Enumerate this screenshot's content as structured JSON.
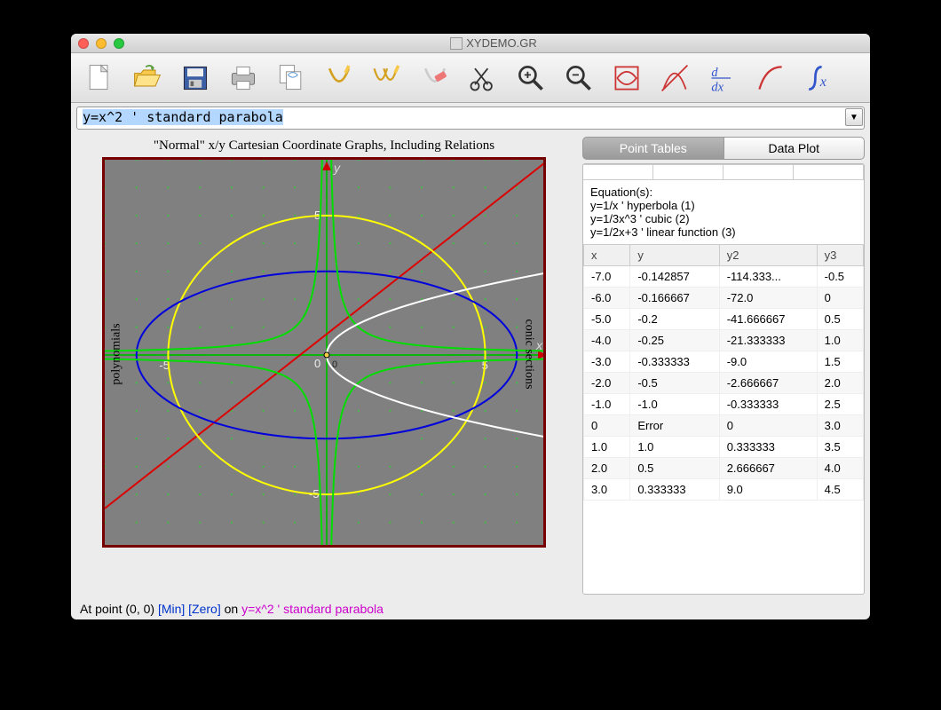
{
  "window": {
    "title": "XYDEMO.GR"
  },
  "toolbar": {
    "items": [
      "new",
      "open",
      "save",
      "print",
      "duplicate",
      "draw1",
      "draw2",
      "erase",
      "cut",
      "zoom-in",
      "zoom-out",
      "grid",
      "tangent",
      "derivative",
      "curve",
      "integral"
    ]
  },
  "input": {
    "value": "y=x^2 ' standard parabola"
  },
  "graph": {
    "title": "\"Normal\" x/y Cartesian Coordinate Graphs, Including Relations",
    "left_label": "polynomials",
    "right_label": "conic sections",
    "axis": {
      "xmin": -7,
      "xmax": 7,
      "ymin": -7,
      "ymax": 7,
      "tick_x": 5,
      "tick_y": 5
    }
  },
  "side_panel": {
    "tabs": {
      "point_tables": "Point Tables",
      "data_plot": "Data Plot",
      "active": "point_tables"
    },
    "equations_header": "Equation(s):",
    "equations": [
      "y=1/x ' hyperbola (1)",
      "y=1/3x^3 ' cubic (2)",
      "y=1/2x+3 ' linear function (3)"
    ],
    "columns": [
      "x",
      "y",
      "y2",
      "y3"
    ],
    "rows": [
      [
        "-7.0",
        "-0.142857",
        "-114.333...",
        "-0.5"
      ],
      [
        "-6.0",
        "-0.166667",
        "-72.0",
        "0"
      ],
      [
        "-5.0",
        "-0.2",
        "-41.666667",
        "0.5"
      ],
      [
        "-4.0",
        "-0.25",
        "-21.333333",
        "1.0"
      ],
      [
        "-3.0",
        "-0.333333",
        "-9.0",
        "1.5"
      ],
      [
        "-2.0",
        "-0.5",
        "-2.666667",
        "2.0"
      ],
      [
        "-1.0",
        "-1.0",
        "-0.333333",
        "2.5"
      ],
      [
        "0",
        "Error",
        "0",
        "3.0"
      ],
      [
        "1.0",
        "1.0",
        "0.333333",
        "3.5"
      ],
      [
        "2.0",
        "0.5",
        "2.666667",
        "4.0"
      ],
      [
        "3.0",
        "0.333333",
        "9.0",
        "4.5"
      ]
    ]
  },
  "status": {
    "prefix": "At point (0, 0) ",
    "min": "[Min]",
    "zero": "[Zero]",
    "on": " on ",
    "equation": "y=x^2 ' standard parabola"
  },
  "chart_data": {
    "type": "line",
    "title": "\"Normal\" x/y Cartesian Coordinate Graphs, Including Relations",
    "xlabel": "x",
    "ylabel": "y",
    "xlim": [
      -7,
      7
    ],
    "ylim": [
      -7,
      7
    ],
    "series": [
      {
        "name": "y=x^2 standard parabola",
        "color": "#cc00cc",
        "type": "parabola"
      },
      {
        "name": "circle r=5",
        "color": "#ffff00",
        "type": "circle",
        "r": 5
      },
      {
        "name": "ellipse",
        "color": "#0000dd",
        "type": "ellipse",
        "rx": 6,
        "ry": 3
      },
      {
        "name": "cubic y=1/3 x^3",
        "color": "#00dddd",
        "type": "cubic"
      },
      {
        "name": "hyperbola y=1/x",
        "color": "#00cc00",
        "type": "hyperbola"
      },
      {
        "name": "line y=x+? diagonal",
        "color": "#dd0000",
        "type": "line"
      },
      {
        "name": "sideways parabola x=y^2",
        "color": "#ffffff",
        "type": "parabola-horiz"
      }
    ]
  }
}
